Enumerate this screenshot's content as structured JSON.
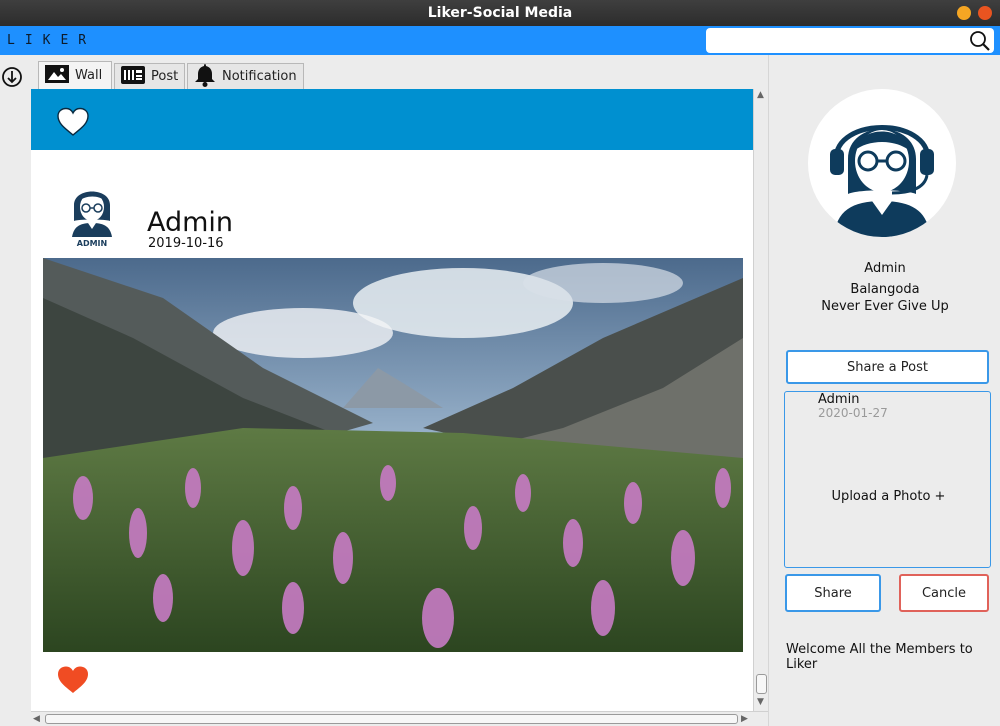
{
  "window": {
    "title": "Liker-Social Media"
  },
  "appbar": {
    "brand": "LIKER",
    "search_value": "",
    "search_icon": "search-icon"
  },
  "tabs": [
    {
      "label": "Wall",
      "icon": "image-icon",
      "active": true
    },
    {
      "label": "Post",
      "icon": "post-icon",
      "active": false
    },
    {
      "label": "Notification",
      "icon": "bell-icon",
      "active": false
    }
  ],
  "post": {
    "author": "Admin",
    "date": "2019-10-16",
    "avatar_label": "ADMIN",
    "photo": "mountain-valley-wildflowers"
  },
  "profile": {
    "name": "Admin",
    "location": "Balangoda",
    "motto": "Never Ever Give Up"
  },
  "composer": {
    "share_post_label": "Share a Post",
    "author": "Admin",
    "date": "2020-01-27",
    "upload_label": "Upload a Photo +",
    "share_label": "Share",
    "cancel_label": "Cancle"
  },
  "welcome": "Welcome All the Members to Liker",
  "colors": {
    "appbar": "#1e90ff",
    "wall_header": "#0090d0",
    "like_heart": "#f04c23",
    "button_border": "#3a98e8",
    "cancel_border": "#e0625a"
  }
}
